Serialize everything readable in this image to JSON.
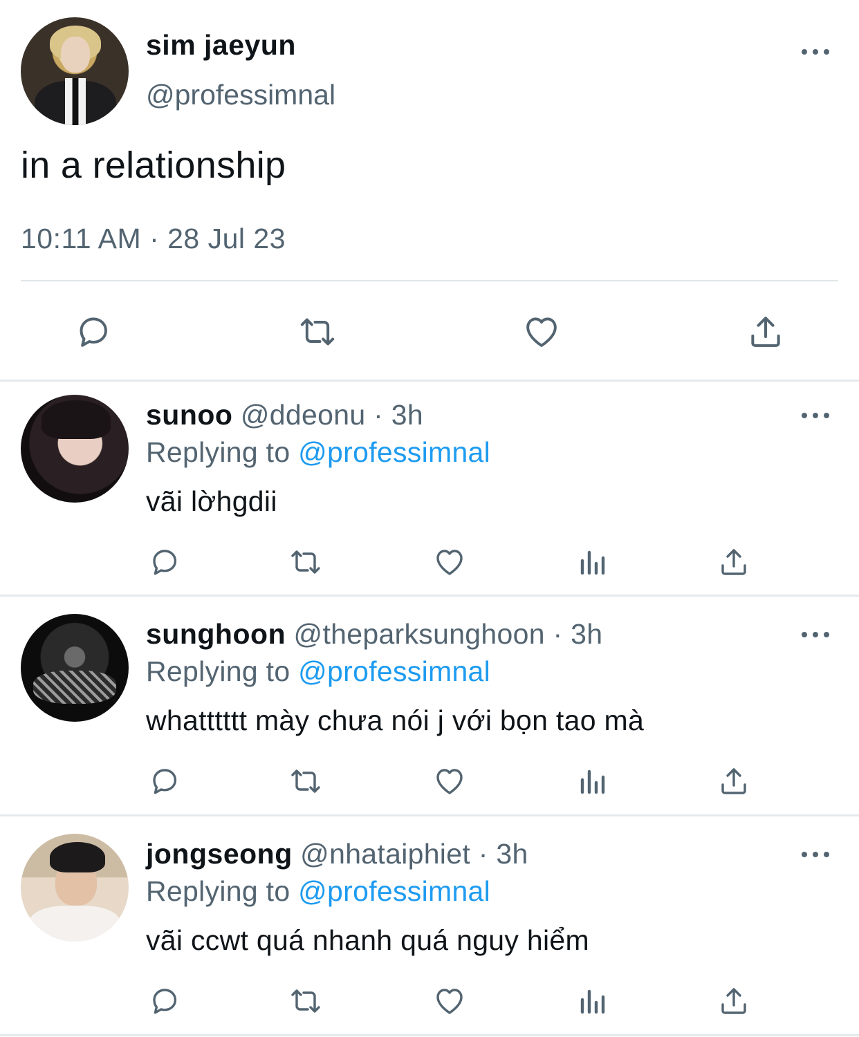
{
  "main_tweet": {
    "display_name": "sim jaeyun",
    "handle": "@professimnal",
    "text": "in a relationship",
    "timestamp": "10:11 AM · 28 Jul 23",
    "actions": [
      "reply-icon",
      "retweet-icon",
      "like-icon",
      "share-icon"
    ]
  },
  "replies": [
    {
      "display_name": "sunoo",
      "handle_time": "@ddeonu · 3h",
      "replying_prefix": "Replying to ",
      "replying_mention": "@professimnal",
      "text": "vãi lờhgdii"
    },
    {
      "display_name": "sunghoon",
      "handle_time": "@theparksunghoon · 3h",
      "replying_prefix": "Replying to ",
      "replying_mention": "@professimnal",
      "text": "whatttttt mày chưa nói j với bọn tao mà"
    },
    {
      "display_name": "jongseong",
      "handle_time": "@nhataiphiet · 3h",
      "replying_prefix": "Replying to ",
      "replying_mention": "@professimnal",
      "text": "vãi ccwt quá nhanh quá nguy hiểm"
    }
  ],
  "colors": {
    "text_primary": "#0f1419",
    "text_secondary": "#536471",
    "mention": "#1d9bf0",
    "icon": "#536471",
    "divider": "#e1e5e8"
  }
}
